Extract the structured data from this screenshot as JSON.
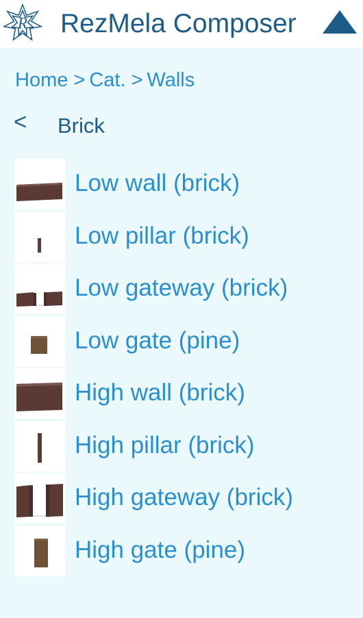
{
  "header": {
    "logo_letter": "R",
    "title": "RezMela Composer",
    "collapse_icon": "triangle-up-icon",
    "brand_color": "#1d5b88"
  },
  "breadcrumb": {
    "items": [
      "Home",
      "Cat.",
      "Walls"
    ],
    "separator": ">"
  },
  "section": {
    "back_label": "<",
    "title": "Brick"
  },
  "items": [
    {
      "label": "Low wall (brick)",
      "thumbnail": "low-wall-thumbnail"
    },
    {
      "label": "Low pillar (brick)",
      "thumbnail": "low-pillar-thumbnail"
    },
    {
      "label": "Low gateway (brick)",
      "thumbnail": "low-gateway-thumbnail"
    },
    {
      "label": "Low gate (pine)",
      "thumbnail": "low-gate-thumbnail"
    },
    {
      "label": "High wall (brick)",
      "thumbnail": "high-wall-thumbnail"
    },
    {
      "label": "High pillar (brick)",
      "thumbnail": "high-pillar-thumbnail"
    },
    {
      "label": "High gateway (brick)",
      "thumbnail": "high-gateway-thumbnail"
    },
    {
      "label": "High gate (pine)",
      "thumbnail": "high-gate-thumbnail"
    }
  ],
  "colors": {
    "background": "#ebf8fc",
    "link": "#2a8fd0",
    "heading": "#1d5b88",
    "brick": "#5a3a35",
    "pine": "#6e5238"
  }
}
